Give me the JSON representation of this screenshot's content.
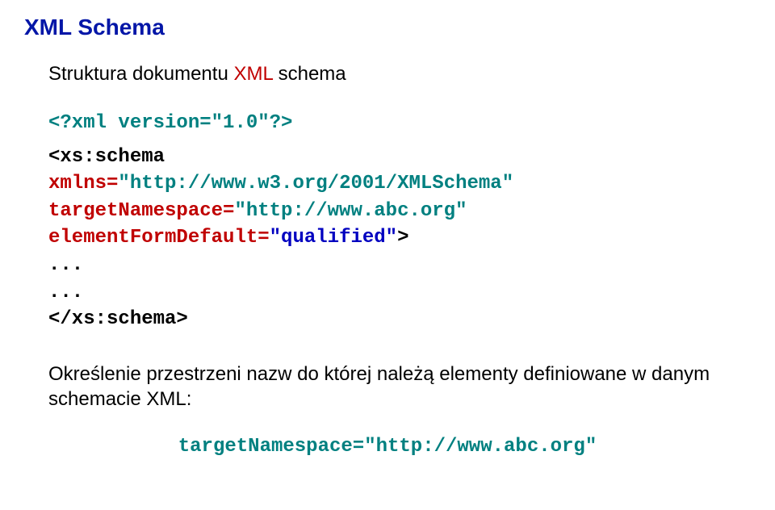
{
  "title": "XML Schema",
  "subtitle_prefix": "Struktura dokumentu ",
  "subtitle_xml": "XML",
  "subtitle_suffix": " schema",
  "code": {
    "line1": "<?xml version=\"1.0\"?>",
    "line2": "<xs:schema",
    "line3_attr": "xmlns=",
    "line3_val": "\"http://www.w3.org/2001/XMLSchema\"",
    "line4_attr": "targetNamespace=",
    "line4_val": "\"http://www.abc.org\"",
    "line5_attr": "elementFormDefault=",
    "line5_val": "\"qualified\"",
    "line5_close": ">",
    "dots1": "...",
    "dots2": "...",
    "close": "</xs:schema>"
  },
  "description": "Określenie przestrzeni nazw do której należą elementy definiowane w danym schemacie XML:",
  "final": "targetNamespace=\"http://www.abc.org\""
}
